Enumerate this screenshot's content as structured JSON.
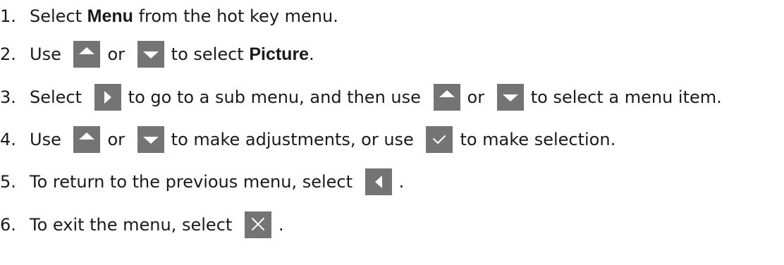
{
  "steps": [
    {
      "number": "1.",
      "parts": [
        {
          "type": "text",
          "text": "Select "
        },
        {
          "type": "bold",
          "text": "Menu"
        },
        {
          "type": "text",
          "text": " from the hot key menu."
        }
      ]
    },
    {
      "number": "2.",
      "parts": [
        {
          "type": "text",
          "text": "Use "
        },
        {
          "type": "icon",
          "icon": "arrow-up-icon"
        },
        {
          "type": "text",
          "text": "or "
        },
        {
          "type": "icon",
          "icon": "arrow-down-icon"
        },
        {
          "type": "text",
          "text": "to select "
        },
        {
          "type": "bold",
          "text": "Picture"
        },
        {
          "type": "text",
          "text": "."
        }
      ]
    },
    {
      "number": "3.",
      "parts": [
        {
          "type": "text",
          "text": "Select "
        },
        {
          "type": "icon",
          "icon": "arrow-right-icon"
        },
        {
          "type": "text",
          "text": "to go to a sub menu, and then use "
        },
        {
          "type": "icon",
          "icon": "arrow-up-icon"
        },
        {
          "type": "text",
          "text": "or "
        },
        {
          "type": "icon",
          "icon": "arrow-down-icon"
        },
        {
          "type": "text",
          "text": "to select a menu item."
        }
      ]
    },
    {
      "number": "4.",
      "parts": [
        {
          "type": "text",
          "text": "Use "
        },
        {
          "type": "icon",
          "icon": "arrow-up-icon"
        },
        {
          "type": "text",
          "text": "or "
        },
        {
          "type": "icon",
          "icon": "arrow-down-icon"
        },
        {
          "type": "text",
          "text": "to make adjustments, or use "
        },
        {
          "type": "icon",
          "icon": "checkmark-icon"
        },
        {
          "type": "text",
          "text": "to make selection."
        }
      ]
    },
    {
      "number": "5.",
      "parts": [
        {
          "type": "text",
          "text": "To return to the previous menu, select "
        },
        {
          "type": "icon",
          "icon": "arrow-left-icon"
        },
        {
          "type": "text",
          "text": "."
        }
      ]
    },
    {
      "number": "6.",
      "parts": [
        {
          "type": "text",
          "text": "To exit the menu, select "
        },
        {
          "type": "icon",
          "icon": "close-icon"
        },
        {
          "type": "text",
          "text": "."
        }
      ]
    }
  ],
  "colors": {
    "text": "#1a1a1a",
    "button_bg": "#747474",
    "button_glyph": "#ffffff"
  }
}
